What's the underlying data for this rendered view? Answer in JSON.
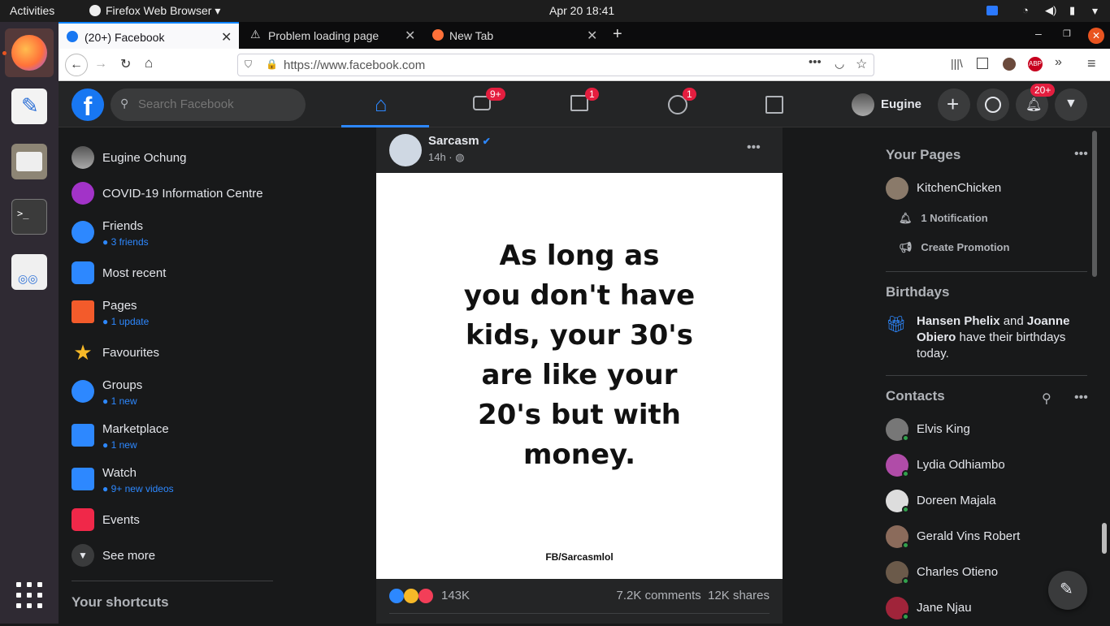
{
  "os": {
    "activities": "Activities",
    "app_menu": "Firefox Web Browser",
    "clock": "Apr 20  18:41"
  },
  "browser": {
    "tabs": [
      {
        "label": "(20+) Facebook"
      },
      {
        "label": "Problem loading page"
      },
      {
        "label": "New Tab"
      }
    ],
    "url": "https://www.facebook.com"
  },
  "facebook": {
    "search_placeholder": "Search Facebook",
    "badges": {
      "watch": "9+",
      "marketplace": "1",
      "groups": "1",
      "notifications": "20+"
    },
    "profile_name": "Eugine",
    "left_nav": [
      {
        "label": "Eugine Ochung",
        "sub": ""
      },
      {
        "label": "COVID-19 Information Centre",
        "sub": ""
      },
      {
        "label": "Friends",
        "sub": "3 friends"
      },
      {
        "label": "Most recent",
        "sub": ""
      },
      {
        "label": "Pages",
        "sub": "1 update"
      },
      {
        "label": "Favourites",
        "sub": ""
      },
      {
        "label": "Groups",
        "sub": "1 new"
      },
      {
        "label": "Marketplace",
        "sub": "1 new"
      },
      {
        "label": "Watch",
        "sub": "9+ new videos"
      },
      {
        "label": "Events",
        "sub": ""
      },
      {
        "label": "See more",
        "sub": ""
      }
    ],
    "shortcuts_title": "Your shortcuts",
    "post": {
      "author": "Sarcasm",
      "time": "14h · ",
      "image_lines": [
        "As long as",
        "you don't have",
        "kids, your 30's",
        "are like your",
        "20's but with",
        "money."
      ],
      "watermark": "FB/Sarcasmlol",
      "reactions": "143K",
      "comments": "7.2K comments",
      "shares": "12K shares"
    },
    "right": {
      "pages_title": "Your Pages",
      "page_name": "KitchenChicken",
      "notification": "1 Notification",
      "promotion": "Create Promotion",
      "birthdays_title": "Birthdays",
      "bday_name1": "Hansen Phelix",
      "bday_and": " and ",
      "bday_name2": "Joanne Obiero",
      "bday_rest": " have their birthdays today.",
      "contacts_title": "Contacts",
      "contacts": [
        "Elvis King",
        "Lydia Odhiambo",
        "Doreen Majala",
        "Gerald Vins Robert",
        "Charles Otieno",
        "Jane Njau"
      ]
    }
  },
  "colors": {
    "fb_blue": "#1877f2",
    "link_blue": "#2d88ff",
    "badge_red": "#e41e3f",
    "online_green": "#31a24c"
  }
}
